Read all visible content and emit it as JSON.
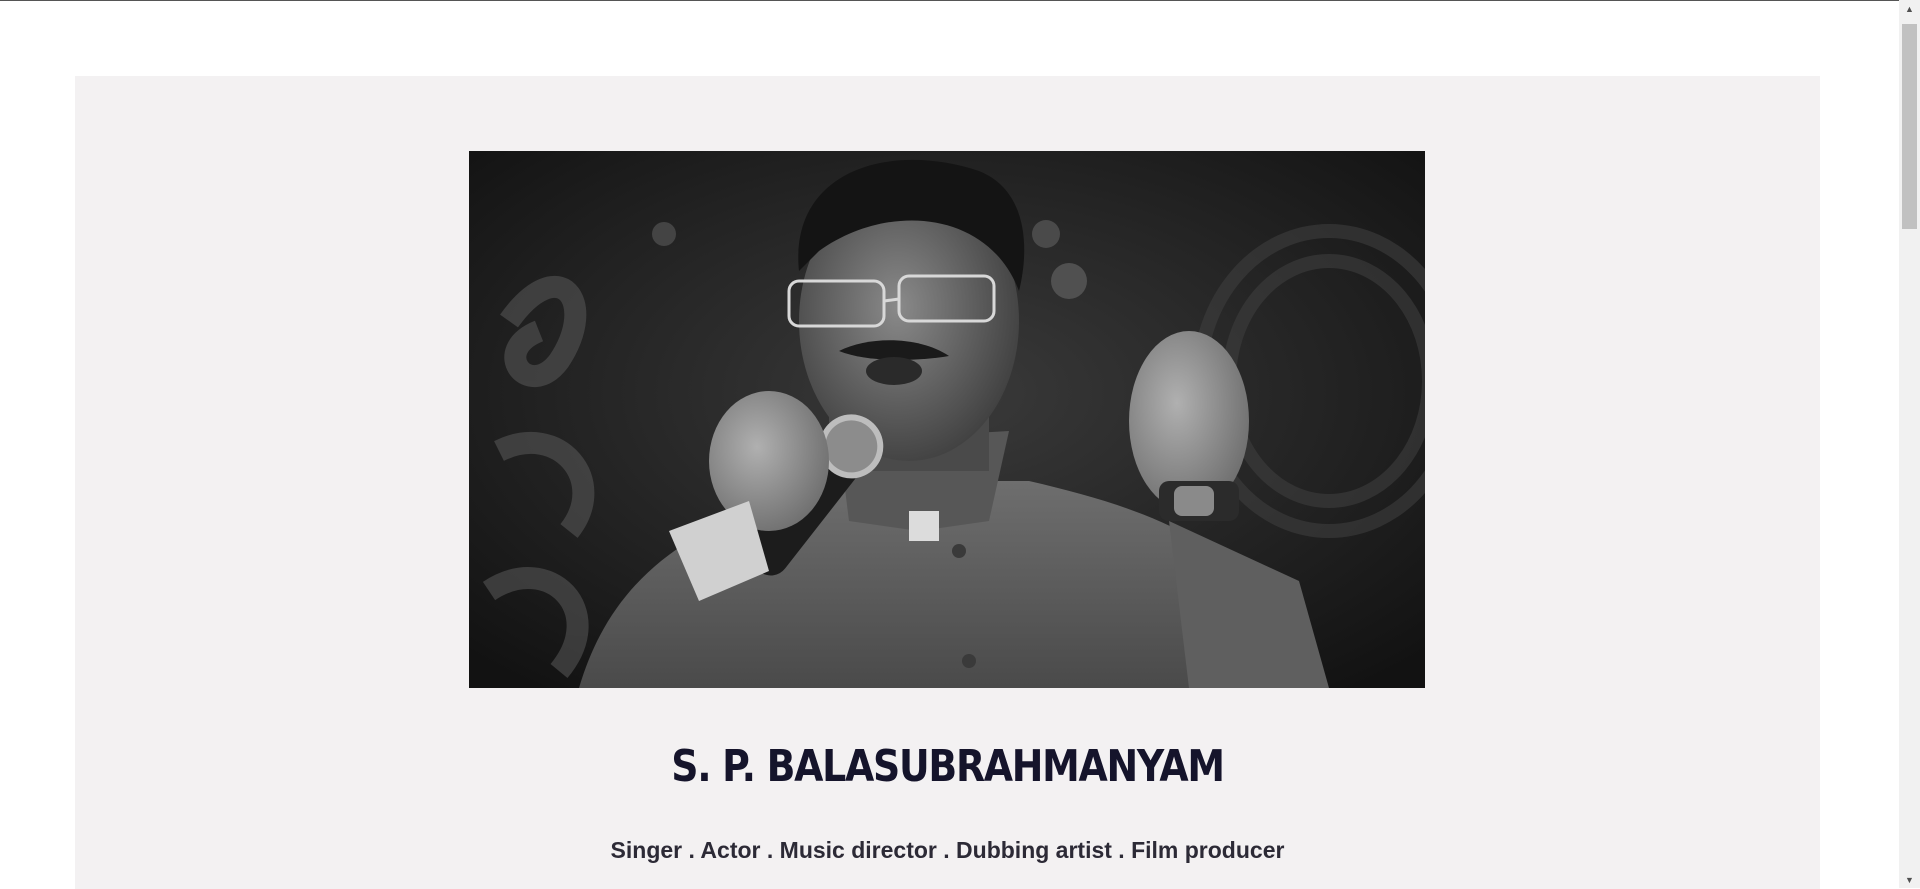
{
  "profile": {
    "name": "S. P. BALASUBRAHMANYAM",
    "roles": "Singer . Actor . Music director . Dubbing artist . Film producer",
    "photo_icon": "singer-portrait-image"
  },
  "colors": {
    "page_bg": "#ffffff",
    "card_bg": "#f3f1f2",
    "title": "#15142b",
    "subtitle": "#2c2a36"
  }
}
